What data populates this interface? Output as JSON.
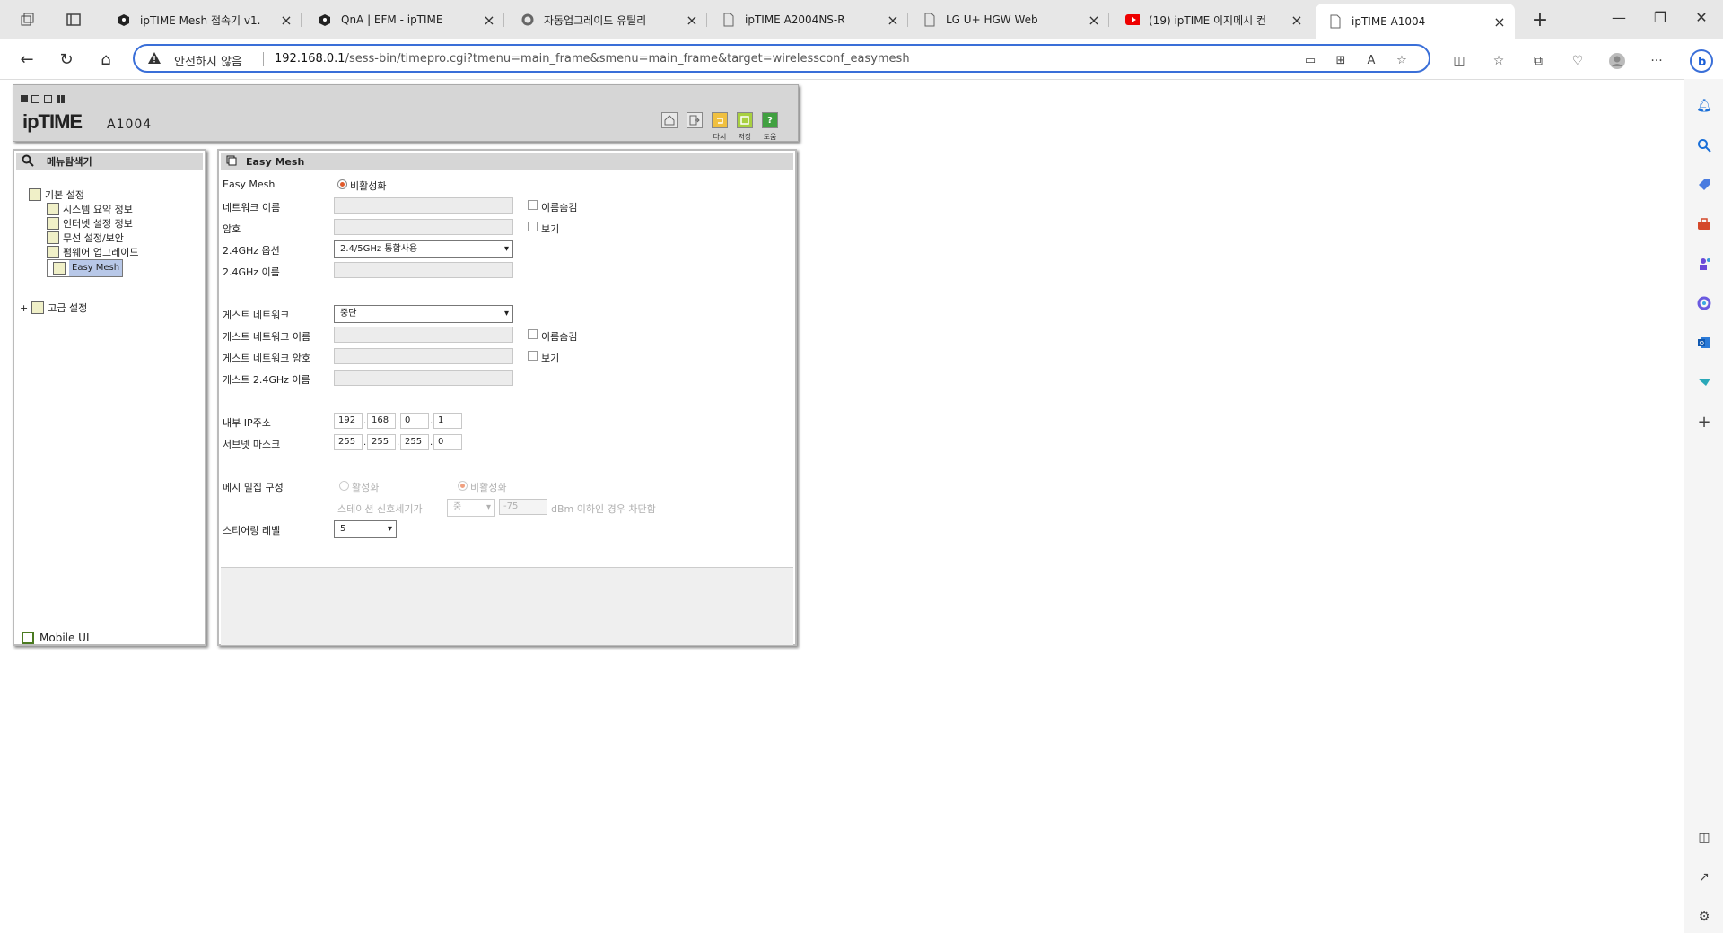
{
  "browser": {
    "tabs": [
      {
        "title": "ipTIME Mesh 접속기 v1.",
        "icon": "iptime-icon"
      },
      {
        "title": "QnA | EFM - ipTIME",
        "icon": "iptime-icon"
      },
      {
        "title": "자동업그레이드 유틸리",
        "icon": "gear-icon"
      },
      {
        "title": "ipTIME A2004NS-R",
        "icon": "page-icon"
      },
      {
        "title": "LG U+ HGW Web",
        "icon": "page-icon"
      },
      {
        "title": "(19) ipTIME 이지메시 컨",
        "icon": "youtube-icon"
      },
      {
        "title": "ipTIME A1004",
        "icon": "page-icon"
      }
    ],
    "security_label": "안전하지 않음",
    "url_host": "192.168.0.1",
    "url_path": "/sess-bin/timepro.cgi?tmenu=main_frame&smenu=main_frame&target=wirelessconf_easymesh",
    "accent": "#3a6fd8"
  },
  "router": {
    "logo": "ipTIME",
    "model": "A1004",
    "header_buttons": [
      {
        "icon": "home-icon",
        "label": ""
      },
      {
        "icon": "logout-icon",
        "label": ""
      },
      {
        "icon": "refresh-icon",
        "label": "다시"
      },
      {
        "icon": "save-icon",
        "label": "저장"
      },
      {
        "icon": "help-icon",
        "label": "도움"
      }
    ]
  },
  "sidebar": {
    "title": "메뉴탐색기",
    "basic": "기본 설정",
    "items": [
      "시스템 요약 정보",
      "인터넷 설정 정보",
      "무선 설정/보안",
      "펌웨어 업그레이드",
      "Easy Mesh"
    ],
    "advanced": "고급 설정",
    "mobile": "Mobile UI"
  },
  "content": {
    "title": "Easy Mesh",
    "easymesh_label": "Easy Mesh",
    "easymesh_value": "비활성화",
    "network_name": "네트워크 이름",
    "hide_name": "이름숨김",
    "password": "암호",
    "show": "보기",
    "option_24": "2.4GHz 옵션",
    "option_24_value": "2.4/5GHz 통합사용",
    "name_24": "2.4GHz 이름",
    "guest_network": "게스트 네트워크",
    "guest_network_value": "중단",
    "guest_name": "게스트 네트워크 이름",
    "guest_password": "게스트 네트워크 암호",
    "guest_24": "게스트 2.4GHz 이름",
    "internal_ip": "내부 IP주소",
    "ip": [
      "192",
      "168",
      "0",
      "1"
    ],
    "subnet": "서브넷 마스크",
    "mask": [
      "255",
      "255",
      "255",
      "0"
    ],
    "mesh_density": "메시 밀집 구성",
    "enable": "활성화",
    "disable": "비활성화",
    "station_signal": "스테이션 신호세기가",
    "signal_level": "중",
    "dbm_value": "-75",
    "dbm_text": "dBm 이하인 경우 차단함",
    "steering": "스티어링 레벨",
    "steering_value": "5"
  }
}
